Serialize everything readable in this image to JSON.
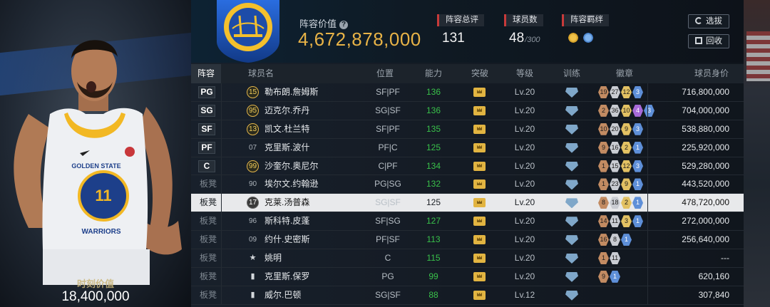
{
  "player_card": {
    "moment_label": "时刻价值",
    "moment_value": "18,400,000",
    "jersey_team": "GOLDEN STATE",
    "jersey_number": "11",
    "jersey_text": "WARRIORS"
  },
  "header": {
    "lineup_value_label": "阵容价值",
    "lineup_value": "4,672,878,000",
    "total_rating_label": "阵容总评",
    "total_rating": "131",
    "player_count_label": "球员数",
    "player_count": "48",
    "player_count_max": "/300",
    "bond_label": "阵容羁绊",
    "select_button": "选拔",
    "recycle_button": "回收"
  },
  "table": {
    "headers": {
      "roster": "阵容",
      "name": "球员名",
      "position": "位置",
      "ability": "能力",
      "breakthrough": "突破",
      "level": "等级",
      "training": "训练",
      "badges": "徽章",
      "salary": "球员身价"
    },
    "rows": [
      {
        "slot": "PG",
        "num": "15",
        "numStyle": "gold",
        "name": "勒布朗.詹姆斯",
        "pos": "SF|PF",
        "ability": "136",
        "level": "Lv.20",
        "salary": "716,800,000",
        "badges": [
          [
            "bronze",
            "19"
          ],
          [
            "silver",
            "27"
          ],
          [
            "gold",
            "12"
          ],
          [
            "blue",
            "3"
          ]
        ]
      },
      {
        "slot": "SG",
        "num": "95",
        "numStyle": "gold",
        "name": "迈克尔.乔丹",
        "pos": "SG|SF",
        "ability": "136",
        "level": "Lv.20",
        "salary": "704,000,000",
        "badges": [
          [
            "bronze",
            "2"
          ],
          [
            "silver",
            "36"
          ],
          [
            "gold",
            "10"
          ],
          [
            "purple",
            "4"
          ],
          [
            "blue",
            "3"
          ]
        ]
      },
      {
        "slot": "SF",
        "num": "13",
        "numStyle": "gold",
        "name": "凯文.杜兰特",
        "pos": "SF|PF",
        "ability": "135",
        "level": "Lv.20",
        "salary": "538,880,000",
        "badges": [
          [
            "bronze",
            "10"
          ],
          [
            "silver",
            "20"
          ],
          [
            "gold",
            "9"
          ],
          [
            "blue",
            "3"
          ]
        ]
      },
      {
        "slot": "PF",
        "num": "07",
        "numStyle": "plain",
        "name": "克里斯.波什",
        "pos": "PF|C",
        "ability": "125",
        "level": "Lv.20",
        "salary": "225,920,000",
        "badges": [
          [
            "bronze",
            "9"
          ],
          [
            "silver",
            "16"
          ],
          [
            "gold",
            "2"
          ],
          [
            "blue",
            "1"
          ]
        ]
      },
      {
        "slot": "C",
        "num": "99",
        "numStyle": "gold",
        "name": "沙奎尔.奥尼尔",
        "pos": "C|PF",
        "ability": "134",
        "level": "Lv.20",
        "salary": "529,280,000",
        "badges": [
          [
            "bronze",
            "1"
          ],
          [
            "silver",
            "15"
          ],
          [
            "gold",
            "12"
          ],
          [
            "blue",
            "3"
          ]
        ]
      },
      {
        "slot": "板凳",
        "num": "90",
        "numStyle": "plain",
        "name": "埃尔文.约翰逊",
        "pos": "PG|SG",
        "ability": "132",
        "level": "Lv.20",
        "salary": "443,520,000",
        "badges": [
          [
            "bronze",
            "1"
          ],
          [
            "silver",
            "23"
          ],
          [
            "gold",
            "9"
          ],
          [
            "blue",
            "1"
          ]
        ]
      },
      {
        "slot": "板凳",
        "num": "17",
        "numStyle": "dark",
        "name": "克莱.汤普森",
        "pos": "SG|SF",
        "ability": "125",
        "level": "Lv.20",
        "salary": "478,720,000",
        "badges": [
          [
            "bronze",
            "8"
          ],
          [
            "silver",
            "18"
          ],
          [
            "gold",
            "2"
          ],
          [
            "blue",
            "1"
          ]
        ],
        "selected": true
      },
      {
        "slot": "板凳",
        "num": "96",
        "numStyle": "plain",
        "name": "斯科特.皮蓬",
        "pos": "SF|SG",
        "ability": "127",
        "level": "Lv.20",
        "salary": "272,000,000",
        "badges": [
          [
            "bronze",
            "14"
          ],
          [
            "silver",
            "11"
          ],
          [
            "gold",
            "3"
          ],
          [
            "blue",
            "1"
          ]
        ]
      },
      {
        "slot": "板凳",
        "num": "09",
        "numStyle": "plain",
        "name": "约什.史密斯",
        "pos": "PF|SF",
        "ability": "113",
        "level": "Lv.20",
        "salary": "256,640,000",
        "badges": [
          [
            "bronze",
            "16"
          ],
          [
            "silver",
            "8"
          ],
          [
            "blue",
            "1"
          ]
        ]
      },
      {
        "slot": "板凳",
        "num": "★",
        "numStyle": "icon",
        "name": "姚明",
        "pos": "C",
        "ability": "115",
        "level": "Lv.20",
        "salary": "---",
        "badges": [
          [
            "bronze",
            "1"
          ],
          [
            "silver",
            "11"
          ]
        ]
      },
      {
        "slot": "板凳",
        "num": "▮",
        "numStyle": "icon",
        "name": "克里斯.保罗",
        "pos": "PG",
        "ability": "99",
        "level": "Lv.20",
        "salary": "620,160",
        "badges": [
          [
            "bronze",
            "9"
          ],
          [
            "blue",
            "1"
          ]
        ]
      },
      {
        "slot": "板凳",
        "num": "▮",
        "numStyle": "icon",
        "name": "威尔.巴顿",
        "pos": "SG|SF",
        "ability": "88",
        "level": "Lv.12",
        "salary": "307,840",
        "badges": []
      }
    ]
  }
}
